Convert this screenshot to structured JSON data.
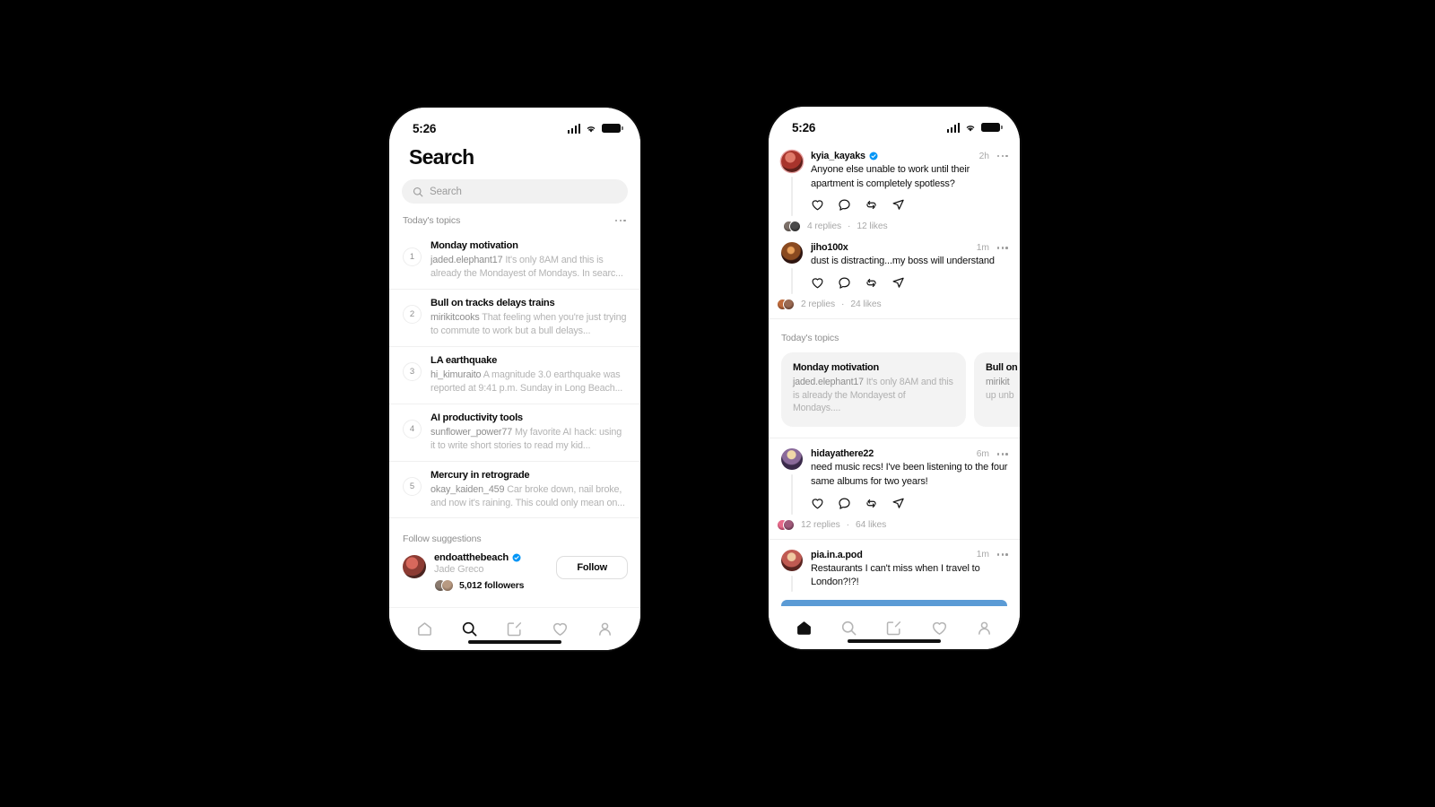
{
  "background_color": "#000000",
  "accent_color": "#5b9bd5",
  "verified_color": "#0095f6",
  "phones": {
    "left": {
      "name": "search-screen",
      "status_bar": {
        "time": "5:26",
        "cellular_icon": "signal-bars-icon",
        "wifi_icon": "wifi-icon",
        "battery_icon": "battery-icon"
      },
      "page_title": "Search",
      "search": {
        "placeholder": "Search",
        "value": "",
        "icon": "search-icon"
      },
      "topics_section": {
        "label": "Today's topics",
        "more_icon": "more-horizontal-icon"
      },
      "topics": [
        {
          "rank": "1",
          "title": "Monday motivation",
          "user": "jaded.elephant17",
          "snippet": "It's only 8AM and this is already the Mondayest of Mondays. In searc..."
        },
        {
          "rank": "2",
          "title": "Bull on tracks delays trains",
          "user": "mirikitcooks",
          "snippet": "That feeling when you're just trying to commute to work but a bull delays..."
        },
        {
          "rank": "3",
          "title": "LA earthquake",
          "user": "hi_kimuraito",
          "snippet": "A magnitude 3.0 earthquake was reported at 9:41 p.m. Sunday in Long Beach..."
        },
        {
          "rank": "4",
          "title": "AI productivity tools",
          "user": "sunflower_power77",
          "snippet": "My favorite AI hack: using it to write short stories to read my kid..."
        },
        {
          "rank": "5",
          "title": "Mercury in retrograde",
          "user": "okay_kaiden_459",
          "snippet": "Car broke down, nail broke, and now it's raining. This could only mean on..."
        }
      ],
      "follow_section": {
        "label": "Follow suggestions",
        "suggestion": {
          "username": "endoatthebeach",
          "verified": true,
          "fullname": "Jade Greco",
          "followers": "5,012 followers",
          "follow_button": "Follow",
          "avatar": "avatar"
        }
      },
      "tabbar": [
        {
          "name": "home",
          "icon": "home-icon",
          "active": false
        },
        {
          "name": "search",
          "icon": "search-icon",
          "active": true
        },
        {
          "name": "compose",
          "icon": "compose-icon",
          "active": false
        },
        {
          "name": "activity",
          "icon": "heart-icon",
          "active": false
        },
        {
          "name": "profile",
          "icon": "person-icon",
          "active": false
        }
      ]
    },
    "right": {
      "name": "feed-screen",
      "status_bar": {
        "time": "5:26",
        "cellular_icon": "signal-bars-icon",
        "wifi_icon": "wifi-icon",
        "battery_icon": "battery-icon"
      },
      "posts": [
        {
          "username": "kyia_kayaks",
          "verified": true,
          "time": "2h",
          "text": "Anyone else unable to work until their apartment is completely spotless?",
          "replies": "4 replies",
          "likes": "12 likes",
          "separator": "·",
          "actions": [
            "like-icon",
            "comment-icon",
            "repost-icon",
            "share-icon"
          ]
        },
        {
          "username": "jiho100x",
          "verified": false,
          "time": "1m",
          "text": "dust is distracting...my boss will understand",
          "replies": "2 replies",
          "likes": "24 likes",
          "separator": "·",
          "actions": [
            "like-icon",
            "comment-icon",
            "repost-icon",
            "share-icon"
          ]
        },
        {
          "username": "hidayathere22",
          "verified": false,
          "time": "6m",
          "text": "need music recs! I've been listening to the four same albums for two years!",
          "replies": "12 replies",
          "likes": "64 likes",
          "separator": "·",
          "actions": [
            "like-icon",
            "comment-icon",
            "repost-icon",
            "share-icon"
          ]
        },
        {
          "username": "pia.in.a.pod",
          "verified": false,
          "time": "1m",
          "text": "Restaurants I can't miss when I travel to London?!?!",
          "replies": "",
          "likes": "",
          "separator": "",
          "actions": []
        }
      ],
      "topics_carousel": {
        "label": "Today's topics",
        "cards": [
          {
            "title": "Monday motivation",
            "user": "jaded.elephant17",
            "snippet": "It's only 8AM and this is already the Mondayest of Mondays...."
          },
          {
            "title": "Bull on",
            "user": "mirikit",
            "snippet": "up unb"
          }
        ]
      },
      "progress_bar": {
        "name": "blue-progress-bar",
        "color": "#5b9bd5"
      },
      "tabbar": [
        {
          "name": "home",
          "icon": "home-icon",
          "active": true
        },
        {
          "name": "search",
          "icon": "search-icon",
          "active": false
        },
        {
          "name": "compose",
          "icon": "compose-icon",
          "active": false
        },
        {
          "name": "activity",
          "icon": "heart-icon",
          "active": false
        },
        {
          "name": "profile",
          "icon": "person-icon",
          "active": false
        }
      ]
    }
  }
}
